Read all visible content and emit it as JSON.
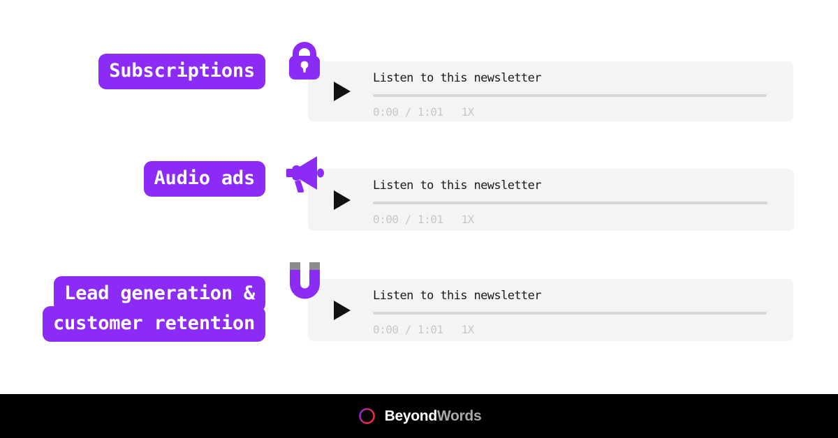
{
  "page": {
    "background_color": "#ffffff",
    "accent_purple": "#8B2BF5",
    "card_background": "#F4F4F4",
    "footer_background": "#000000"
  },
  "rows": [
    {
      "label_lines": [
        "Subscriptions"
      ],
      "icon_name": "lock-icon",
      "player": {
        "title": "Listen to this newsletter",
        "play_label": "Play",
        "current_time": "0:00",
        "separator": "/",
        "duration": "1:01",
        "time_display": "0:00 / 1:01",
        "speed": "1X",
        "progress_percent": 0
      }
    },
    {
      "label_lines": [
        "Audio ads"
      ],
      "icon_name": "megaphone-icon",
      "player": {
        "title": "Listen to this newsletter",
        "play_label": "Play",
        "current_time": "0:00",
        "separator": "/",
        "duration": "1:01",
        "time_display": "0:00 / 1:01",
        "speed": "1X",
        "progress_percent": 0
      }
    },
    {
      "label_lines": [
        "Lead generation &",
        "customer retention"
      ],
      "icon_name": "magnet-icon",
      "player": {
        "title": "Listen to this newsletter",
        "play_label": "Play",
        "current_time": "0:00",
        "separator": "/",
        "duration": "1:01",
        "time_display": "0:00 / 1:01",
        "speed": "1X",
        "progress_percent": 0
      }
    }
  ],
  "footer": {
    "logo_icon_name": "beyondwords-logo-icon",
    "brand_first": "Beyond",
    "brand_second": "Words",
    "brand_full": "BeyondWords"
  }
}
